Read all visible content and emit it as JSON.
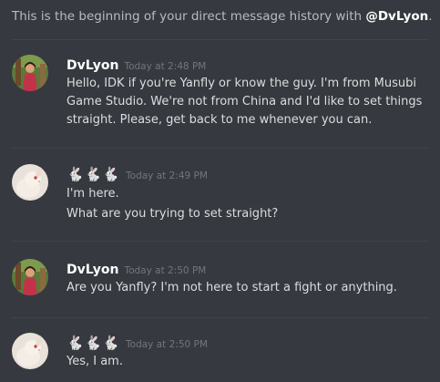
{
  "intro": {
    "prefix": "This is the beginning of your direct message history with ",
    "handle": "@DvLyon",
    "suffix": "."
  },
  "messages": [
    {
      "username": "DvLyon",
      "avatar": "dvlyon-avatar",
      "timestamp": "Today at 2:48 PM",
      "lines": [
        "Hello, IDK if you're Yanfly or know the guy. I'm from Musubi Game Studio. We're not from China and I'd like to set things straight. Please, get back to me whenever you can."
      ]
    },
    {
      "username": "🐇🐇🐇",
      "avatar": "rabbit-avatar",
      "timestamp": "Today at 2:49 PM",
      "lines": [
        "I'm here.",
        "What are you trying to set straight?"
      ]
    },
    {
      "username": "DvLyon",
      "avatar": "dvlyon-avatar",
      "timestamp": "Today at 2:50 PM",
      "lines": [
        "Are you Yanfly? I'm not here to start a fight or anything."
      ]
    },
    {
      "username": "🐇🐇🐇",
      "avatar": "rabbit-avatar",
      "timestamp": "Today at 2:50 PM",
      "lines": [
        "Yes, I am."
      ]
    }
  ],
  "colors": {
    "background": "#36393f",
    "username": "#ffffff",
    "timestamp": "#72767d",
    "text": "#dcddde",
    "divider": "#40434a"
  }
}
